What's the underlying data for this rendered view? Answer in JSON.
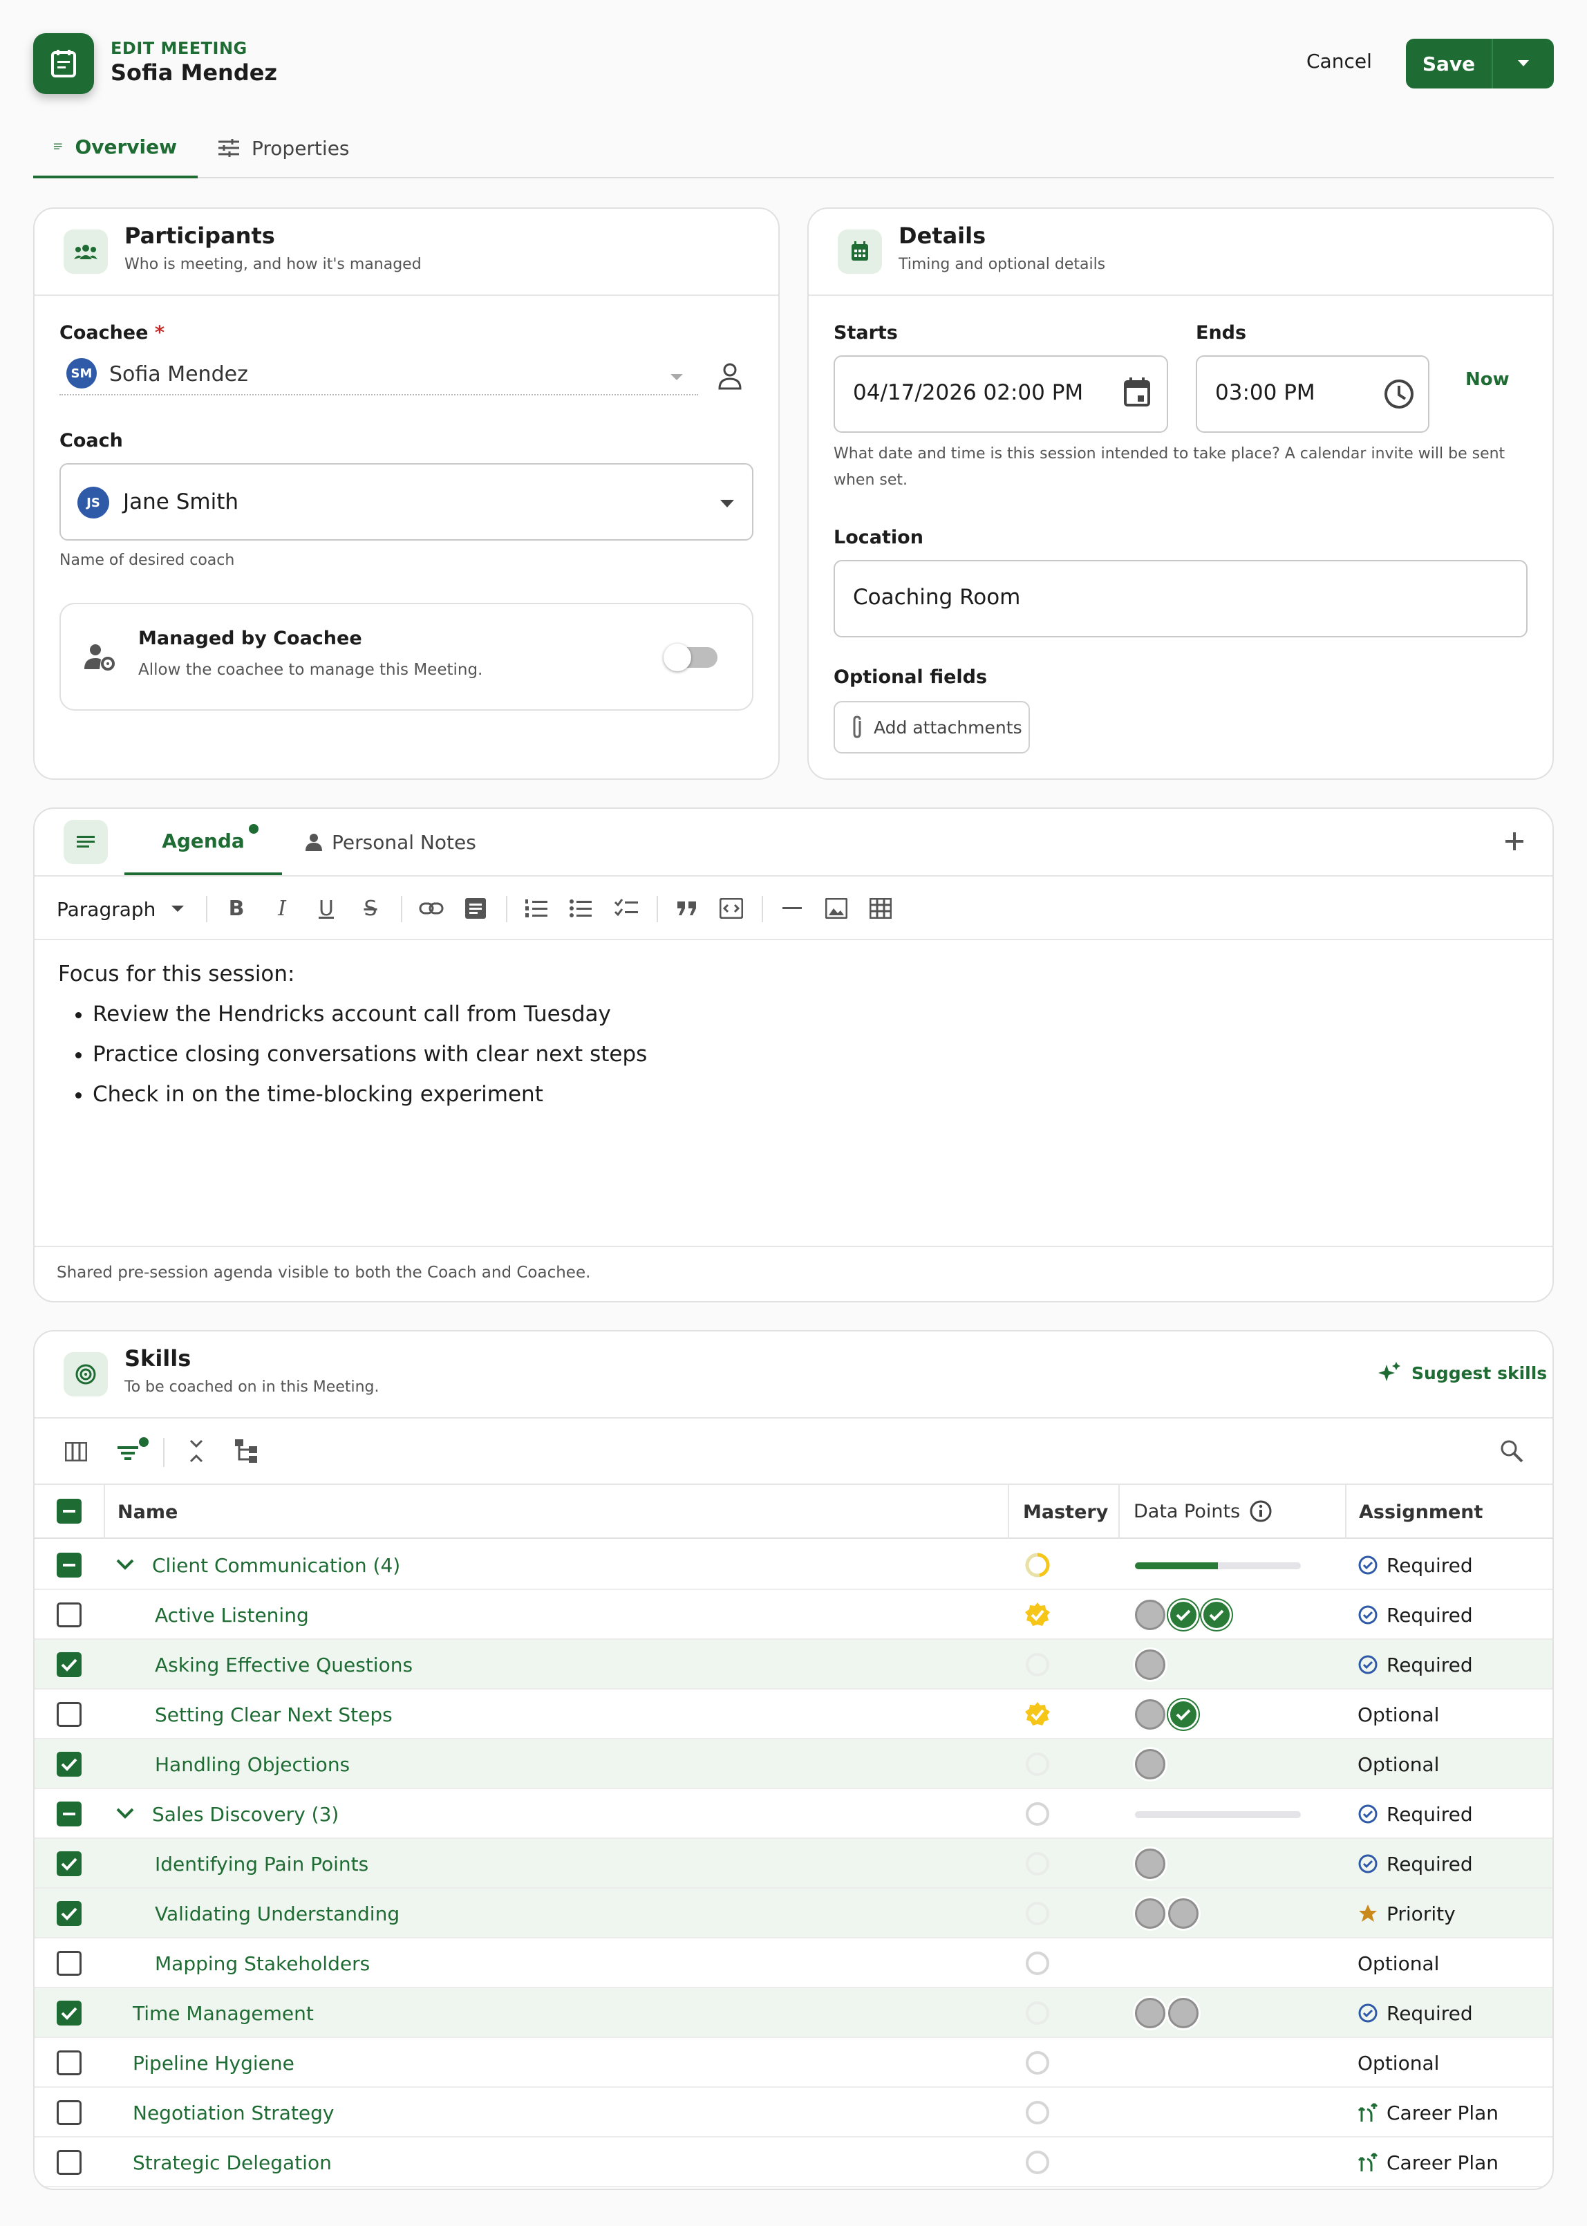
{
  "header": {
    "eyebrow": "EDIT MEETING",
    "name": "Sofia Mendez",
    "cancel": "Cancel",
    "save": "Save"
  },
  "tabs": [
    {
      "label": "Overview",
      "active": true
    },
    {
      "label": "Properties",
      "active": false
    }
  ],
  "participants": {
    "title": "Participants",
    "subtitle": "Who is meeting, and how it's managed",
    "coachee_label": "Coachee",
    "required_mark": "*",
    "coachee_initials": "SM",
    "coachee_value": "Sofia Mendez",
    "coach_label": "Coach",
    "coach_initials": "JS",
    "coach_value": "Jane Smith",
    "coach_hint": "Name of desired coach",
    "managed_title": "Managed by Coachee",
    "managed_desc": "Allow the coachee to manage this Meeting.",
    "managed_on": false
  },
  "details": {
    "title": "Details",
    "subtitle": "Timing and optional details",
    "starts_label": "Starts",
    "starts_value": "04/17/2026 02:00 PM",
    "ends_label": "Ends",
    "ends_value": "03:00 PM",
    "now": "Now",
    "time_hint": "What date and time is this session intended to take place? A calendar invite will be sent when set.",
    "location_label": "Location",
    "location_value": "Coaching Room",
    "optional_label": "Optional fields",
    "attach": "Add attachments"
  },
  "agenda": {
    "tab_agenda": "Agenda",
    "tab_notes": "Personal Notes",
    "paragraph": "Paragraph",
    "intro": "Focus for this session:",
    "bullets": [
      "Review the Hendricks account call from Tuesday",
      "Practice closing conversations with clear next steps",
      "Check in on the time-blocking experiment"
    ],
    "footer": "Shared pre-session agenda visible to both the Coach and Coachee."
  },
  "skills": {
    "title": "Skills",
    "subtitle": "To be coached on in this Meeting.",
    "suggest": "Suggest skills",
    "columns": {
      "name": "Name",
      "mastery": "Mastery",
      "data_points": "Data Points",
      "assignment": "Assignment"
    },
    "rows": [
      {
        "name": "Client Communication (4)",
        "level": 0,
        "group": true,
        "check": "ind",
        "mastery": "partial",
        "progress": 0.5,
        "dots": [],
        "assignment": "Required",
        "icon": "required"
      },
      {
        "name": "Active Listening",
        "level": 1,
        "group": false,
        "check": "off",
        "mastery": "badge",
        "dots": [
          "g",
          "c",
          "c"
        ],
        "assignment": "Required",
        "icon": "required"
      },
      {
        "name": "Asking Effective Questions",
        "level": 1,
        "group": false,
        "check": "on",
        "mastery": "faint",
        "dots": [
          "g"
        ],
        "assignment": "Required",
        "icon": "required"
      },
      {
        "name": "Setting Clear Next Steps",
        "level": 1,
        "group": false,
        "check": "off",
        "mastery": "badge",
        "dots": [
          "g",
          "c"
        ],
        "assignment": "Optional",
        "icon": "none"
      },
      {
        "name": "Handling Objections",
        "level": 1,
        "group": false,
        "check": "on",
        "mastery": "faint",
        "dots": [
          "g"
        ],
        "assignment": "Optional",
        "icon": "none"
      },
      {
        "name": "Sales Discovery (3)",
        "level": 0,
        "group": true,
        "check": "ind",
        "mastery": "empty",
        "progress": 0,
        "dots": [],
        "assignment": "Required",
        "icon": "required"
      },
      {
        "name": "Identifying Pain Points",
        "level": 1,
        "group": false,
        "check": "on",
        "mastery": "faint",
        "dots": [
          "g"
        ],
        "assignment": "Required",
        "icon": "required"
      },
      {
        "name": "Validating Understanding",
        "level": 1,
        "group": false,
        "check": "on",
        "mastery": "faint",
        "dots": [
          "g",
          "g"
        ],
        "assignment": "Priority",
        "icon": "priority"
      },
      {
        "name": "Mapping Stakeholders",
        "level": 1,
        "group": false,
        "check": "off",
        "mastery": "empty",
        "dots": [],
        "assignment": "Optional",
        "icon": "none"
      },
      {
        "name": "Time Management",
        "level": 0,
        "group": false,
        "check": "on",
        "mastery": "faint",
        "dots": [
          "g",
          "g"
        ],
        "assignment": "Required",
        "icon": "required"
      },
      {
        "name": "Pipeline Hygiene",
        "level": 0,
        "group": false,
        "check": "off",
        "mastery": "empty",
        "dots": [],
        "assignment": "Optional",
        "icon": "none"
      },
      {
        "name": "Negotiation Strategy",
        "level": 0,
        "group": false,
        "check": "off",
        "mastery": "empty",
        "dots": [],
        "assignment": "Career Plan",
        "icon": "career"
      },
      {
        "name": "Strategic Delegation",
        "level": 0,
        "group": false,
        "check": "off",
        "mastery": "empty",
        "dots": [],
        "assignment": "Career Plan",
        "icon": "career"
      }
    ]
  },
  "colors": {
    "brand": "#1e6b33",
    "mastery_gold": "#f5c518",
    "priority_star": "#c98a1b"
  }
}
